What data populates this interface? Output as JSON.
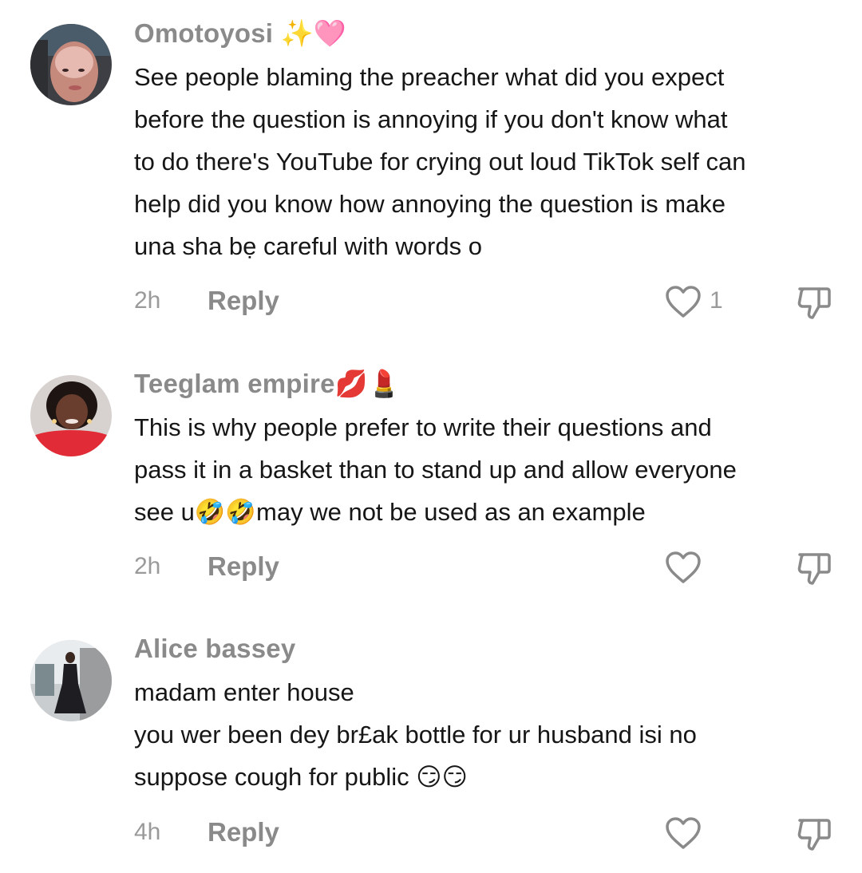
{
  "comments": [
    {
      "username": "Omotoyosi",
      "username_emoji": "✨🩷",
      "lines": [
        "See people blaming the preacher what did you expect",
        "before the question is annoying if you don't know what",
        "to do there's YouTube for crying out loud TikTok self can",
        "help did you know how annoying the question is make",
        "una sha bẹ careful with words o"
      ],
      "time": "2h",
      "reply_label": "Reply",
      "like_count": "1",
      "like_icon": "heart-outline-icon",
      "dislike_icon": "thumbs-down-outline-icon"
    },
    {
      "username": "Teeglam empire",
      "username_emoji": "💋💄",
      "lines": [
        "This is why people prefer to write their questions and",
        "pass it in a basket than to stand up and allow everyone",
        "see u🤣🤣may we not be used as an example"
      ],
      "time": "2h",
      "reply_label": "Reply",
      "like_icon": "heart-outline-icon",
      "dislike_icon": "thumbs-down-outline-icon"
    },
    {
      "username": "Alice bassey",
      "username_emoji": "",
      "lines": [
        "madam enter house",
        "you wer been dey br£ak bottle for ur husband isi no",
        "suppose cough for public 😏😏"
      ],
      "time": "4h",
      "reply_label": "Reply",
      "like_icon": "heart-outline-icon",
      "dislike_icon": "thumbs-down-outline-icon"
    }
  ],
  "colors": {
    "username": "#8a8a8a",
    "text": "#161616",
    "meta": "#9a9a9a",
    "icon": "#8a8a8a",
    "background": "#ffffff"
  }
}
